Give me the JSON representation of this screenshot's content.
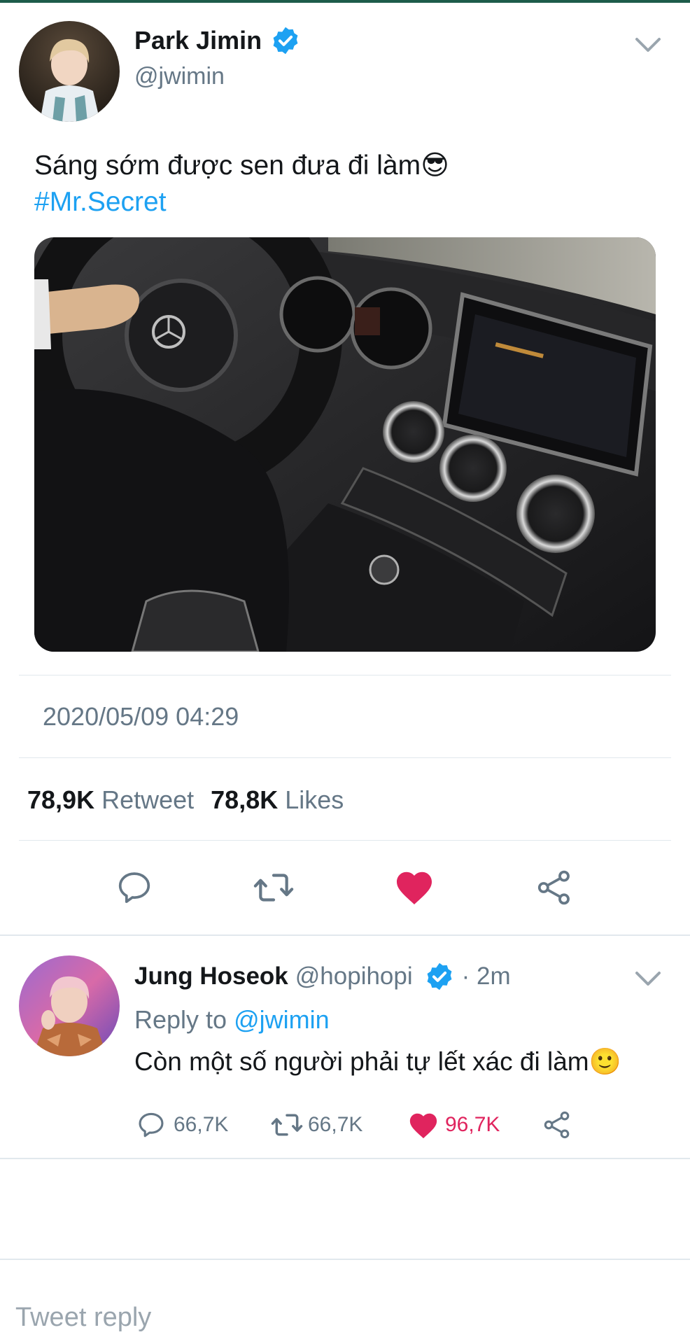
{
  "tweet": {
    "author_name": "Park Jimin",
    "author_handle": "@jwimin",
    "text": "Sáng sớm được sen đưa đi làm😎",
    "hashtag": "#Mr.Secret",
    "timestamp": "2020/05/09 04:29",
    "retweet_count": "78,9K",
    "retweet_label": "Retweet",
    "like_count": "78,8K",
    "like_label": "Likes"
  },
  "reply": {
    "author_name": "Jung Hoseok",
    "author_handle": "@hopihopi",
    "time": "· 2m",
    "reply_to_label": "Reply to",
    "reply_to_handle": "@jwimin",
    "text": "Còn một số người phải tự lết xác đi làm🙂",
    "reply_count": "66,7K",
    "retweet_count": "66,7K",
    "like_count": "96,7K"
  },
  "composer": {
    "placeholder": "Tweet reply"
  },
  "colors": {
    "accent": "#1da1f2",
    "like": "#e0245e",
    "text": "#14171a",
    "secondary": "#657786",
    "divider": "#e1e8ed"
  },
  "icons": [
    "verified-badge-icon",
    "chevron-down-icon",
    "reply-icon",
    "retweet-icon",
    "like-icon",
    "share-icon"
  ]
}
